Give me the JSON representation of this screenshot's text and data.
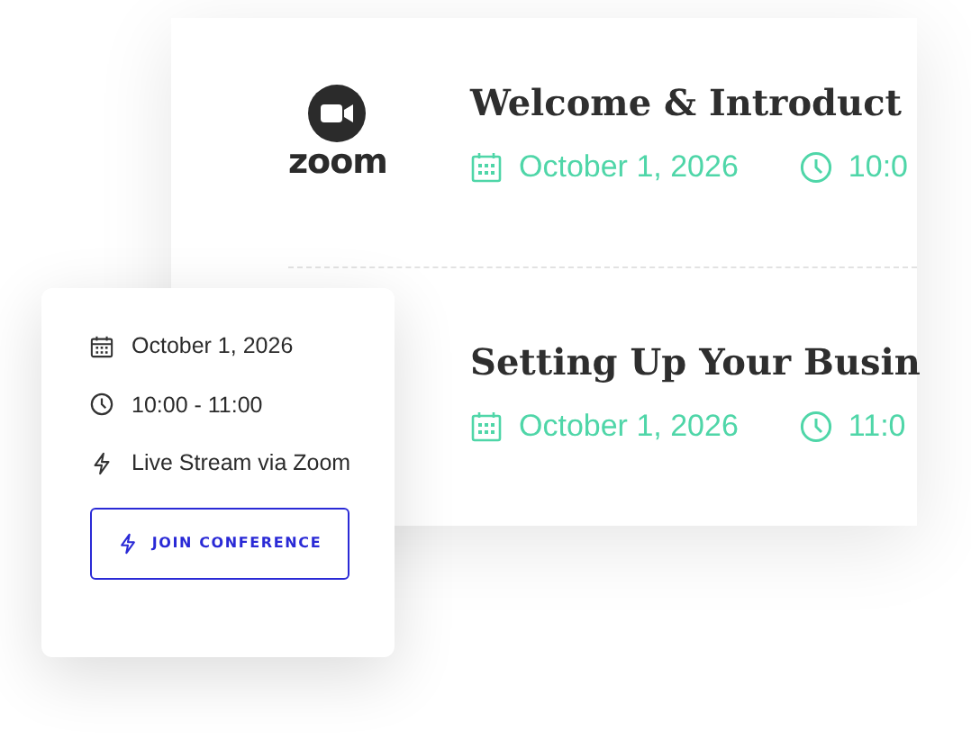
{
  "sessions": [
    {
      "logo": {
        "kind": "zoom",
        "text": "zoom"
      },
      "title": "Welcome & Introduct",
      "date": "October 1, 2026",
      "time": "10:0"
    },
    {
      "title": "Setting Up Your Busin",
      "date": "October 1, 2026",
      "time": "11:0"
    }
  ],
  "details": {
    "items": [
      {
        "kind": "date",
        "text": "October 1, 2026"
      },
      {
        "kind": "time",
        "text": "10:00 - 11:00"
      },
      {
        "kind": "stream",
        "text": "Live Stream via Zoom"
      }
    ],
    "button": "JOIN CONFERENCE"
  }
}
